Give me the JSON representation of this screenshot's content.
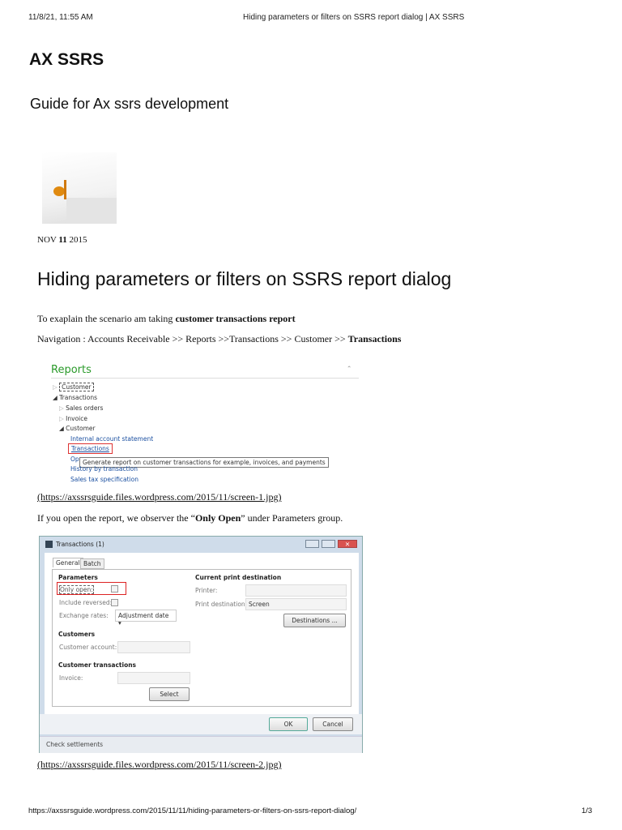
{
  "print_header": {
    "datetime": "11/8/21, 11:55 AM",
    "title": "Hiding parameters or filters on SSRS report dialog | AX SSRS"
  },
  "site": {
    "title": "AX SSRS",
    "tagline": "Guide for Ax ssrs development"
  },
  "post": {
    "date_month": "NOV",
    "date_day": "11",
    "date_year": "2015",
    "title": "Hiding parameters or filters on SSRS report dialog",
    "intro_text": "To exaplain the scenario am taking ",
    "intro_bold": "customer transactions report",
    "nav_text": "Navigation : Accounts Receivable >> Reports >>Transactions >> Customer >> ",
    "nav_bold": "Transactions",
    "screen1_link": "(https://axssrsguide.files.wordpress.com/2015/11/screen-1.jpg)",
    "open_text_1": "If you open the report, we observer the “",
    "open_bold": "Only Open",
    "open_text_2": "” under Parameters group.",
    "screen2_link": "(https://axssrsguide.files.wordpress.com/2015/11/screen-2.jpg)"
  },
  "screen1": {
    "heading": "Reports",
    "items": [
      "Customer",
      "Transactions",
      "Sales orders",
      "Invoice",
      "Customer",
      "Internal account statement",
      "Transactions",
      "Op",
      "History by transaction",
      "Sales tax specification"
    ],
    "tooltip": "Generate report on customer transactions for example, invoices, and payments"
  },
  "screen2": {
    "window_title": "Transactions (1)",
    "tabs": [
      "General",
      "Batch"
    ],
    "parameters_heading": "Parameters",
    "only_open": "Only open:",
    "include_reversed": "Include reversed:",
    "exchange_rates": "Exchange rates:",
    "exchange_value": "Adjustment date",
    "customers_heading": "Customers",
    "customer_account": "Customer account:",
    "cust_trans_heading": "Customer transactions",
    "invoice": "Invoice:",
    "select": "Select",
    "print_heading": "Current print destination",
    "printer": "Printer:",
    "print_destination": "Print destination:",
    "print_destination_value": "Screen",
    "destinations": "Destinations ...",
    "ok": "OK",
    "cancel": "Cancel",
    "status": "Check settlements"
  },
  "footer": {
    "url": "https://axssrsguide.wordpress.com/2015/11/11/hiding-parameters-or-filters-on-ssrs-report-dialog/",
    "page": "1/3"
  }
}
